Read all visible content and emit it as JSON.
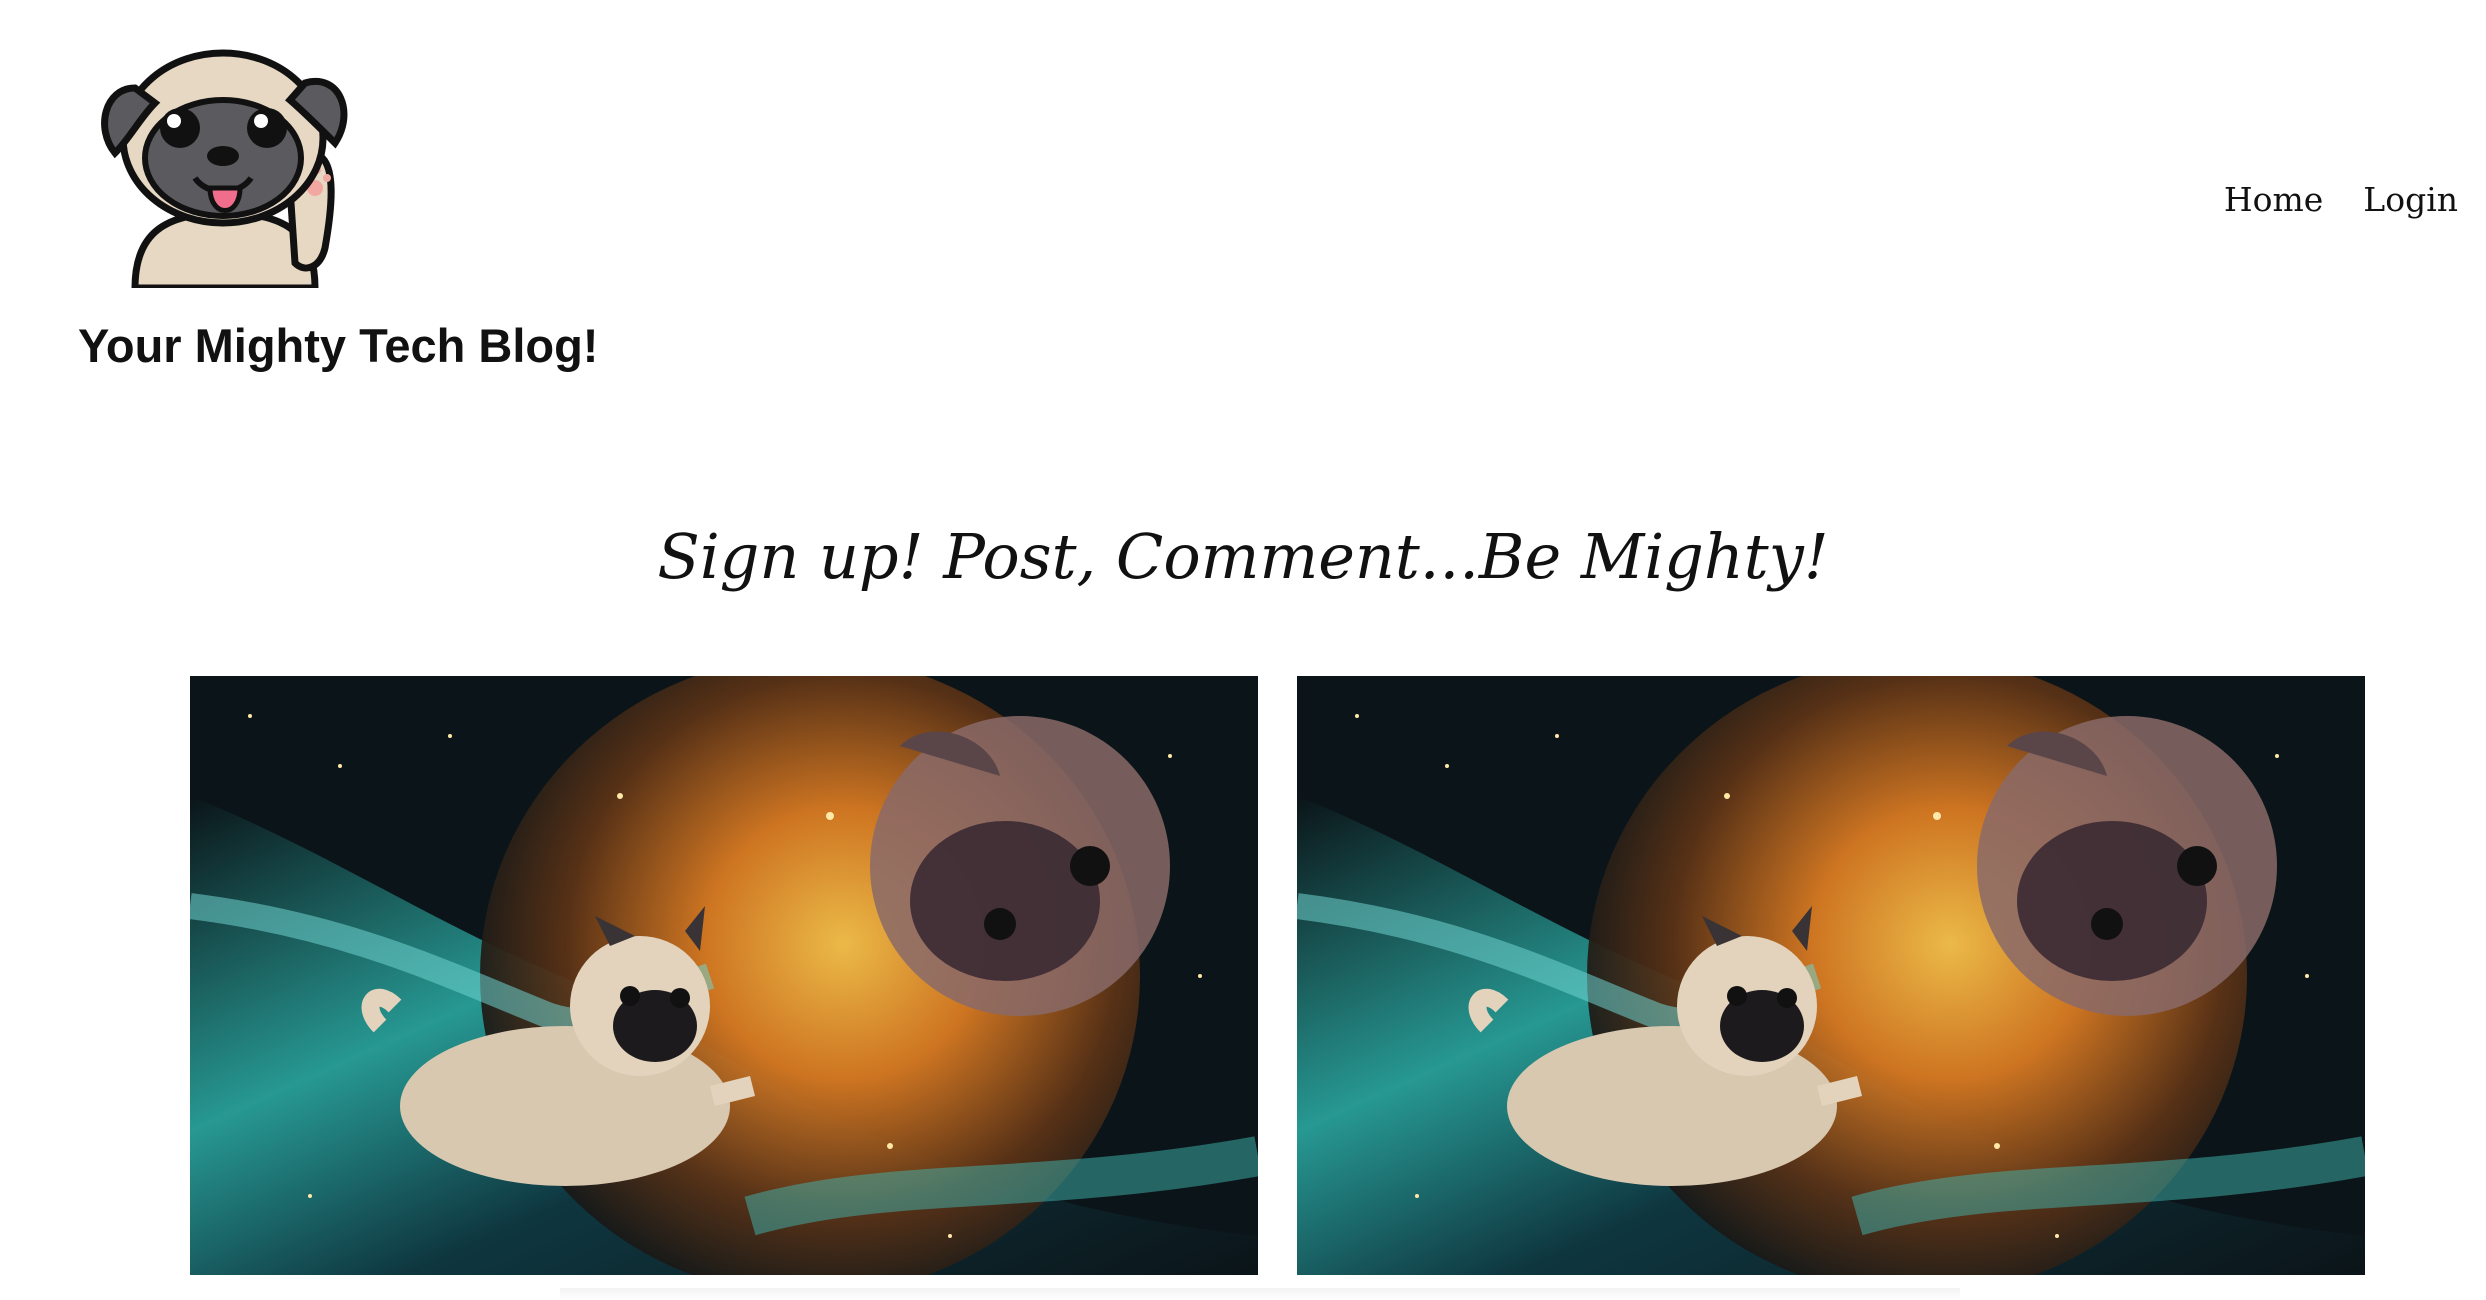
{
  "header": {
    "logo_icon": "pug-waving-icon",
    "blog_title": "Your Mighty Tech Blog!"
  },
  "nav": {
    "items": [
      {
        "label": "Home"
      },
      {
        "label": "Login"
      }
    ]
  },
  "main": {
    "tagline": "Sign up! Post, Comment...Be Mighty!",
    "hero_images": [
      {
        "icon": "space-pug-image"
      },
      {
        "icon": "space-pug-image"
      }
    ]
  },
  "colors": {
    "pug_fur": "#e6d8c3",
    "pug_mask": "#5b5a5f",
    "space_dark": "#0b1418",
    "nebula_orange": "#e08a2a",
    "nebula_teal": "#2aa7a0"
  }
}
